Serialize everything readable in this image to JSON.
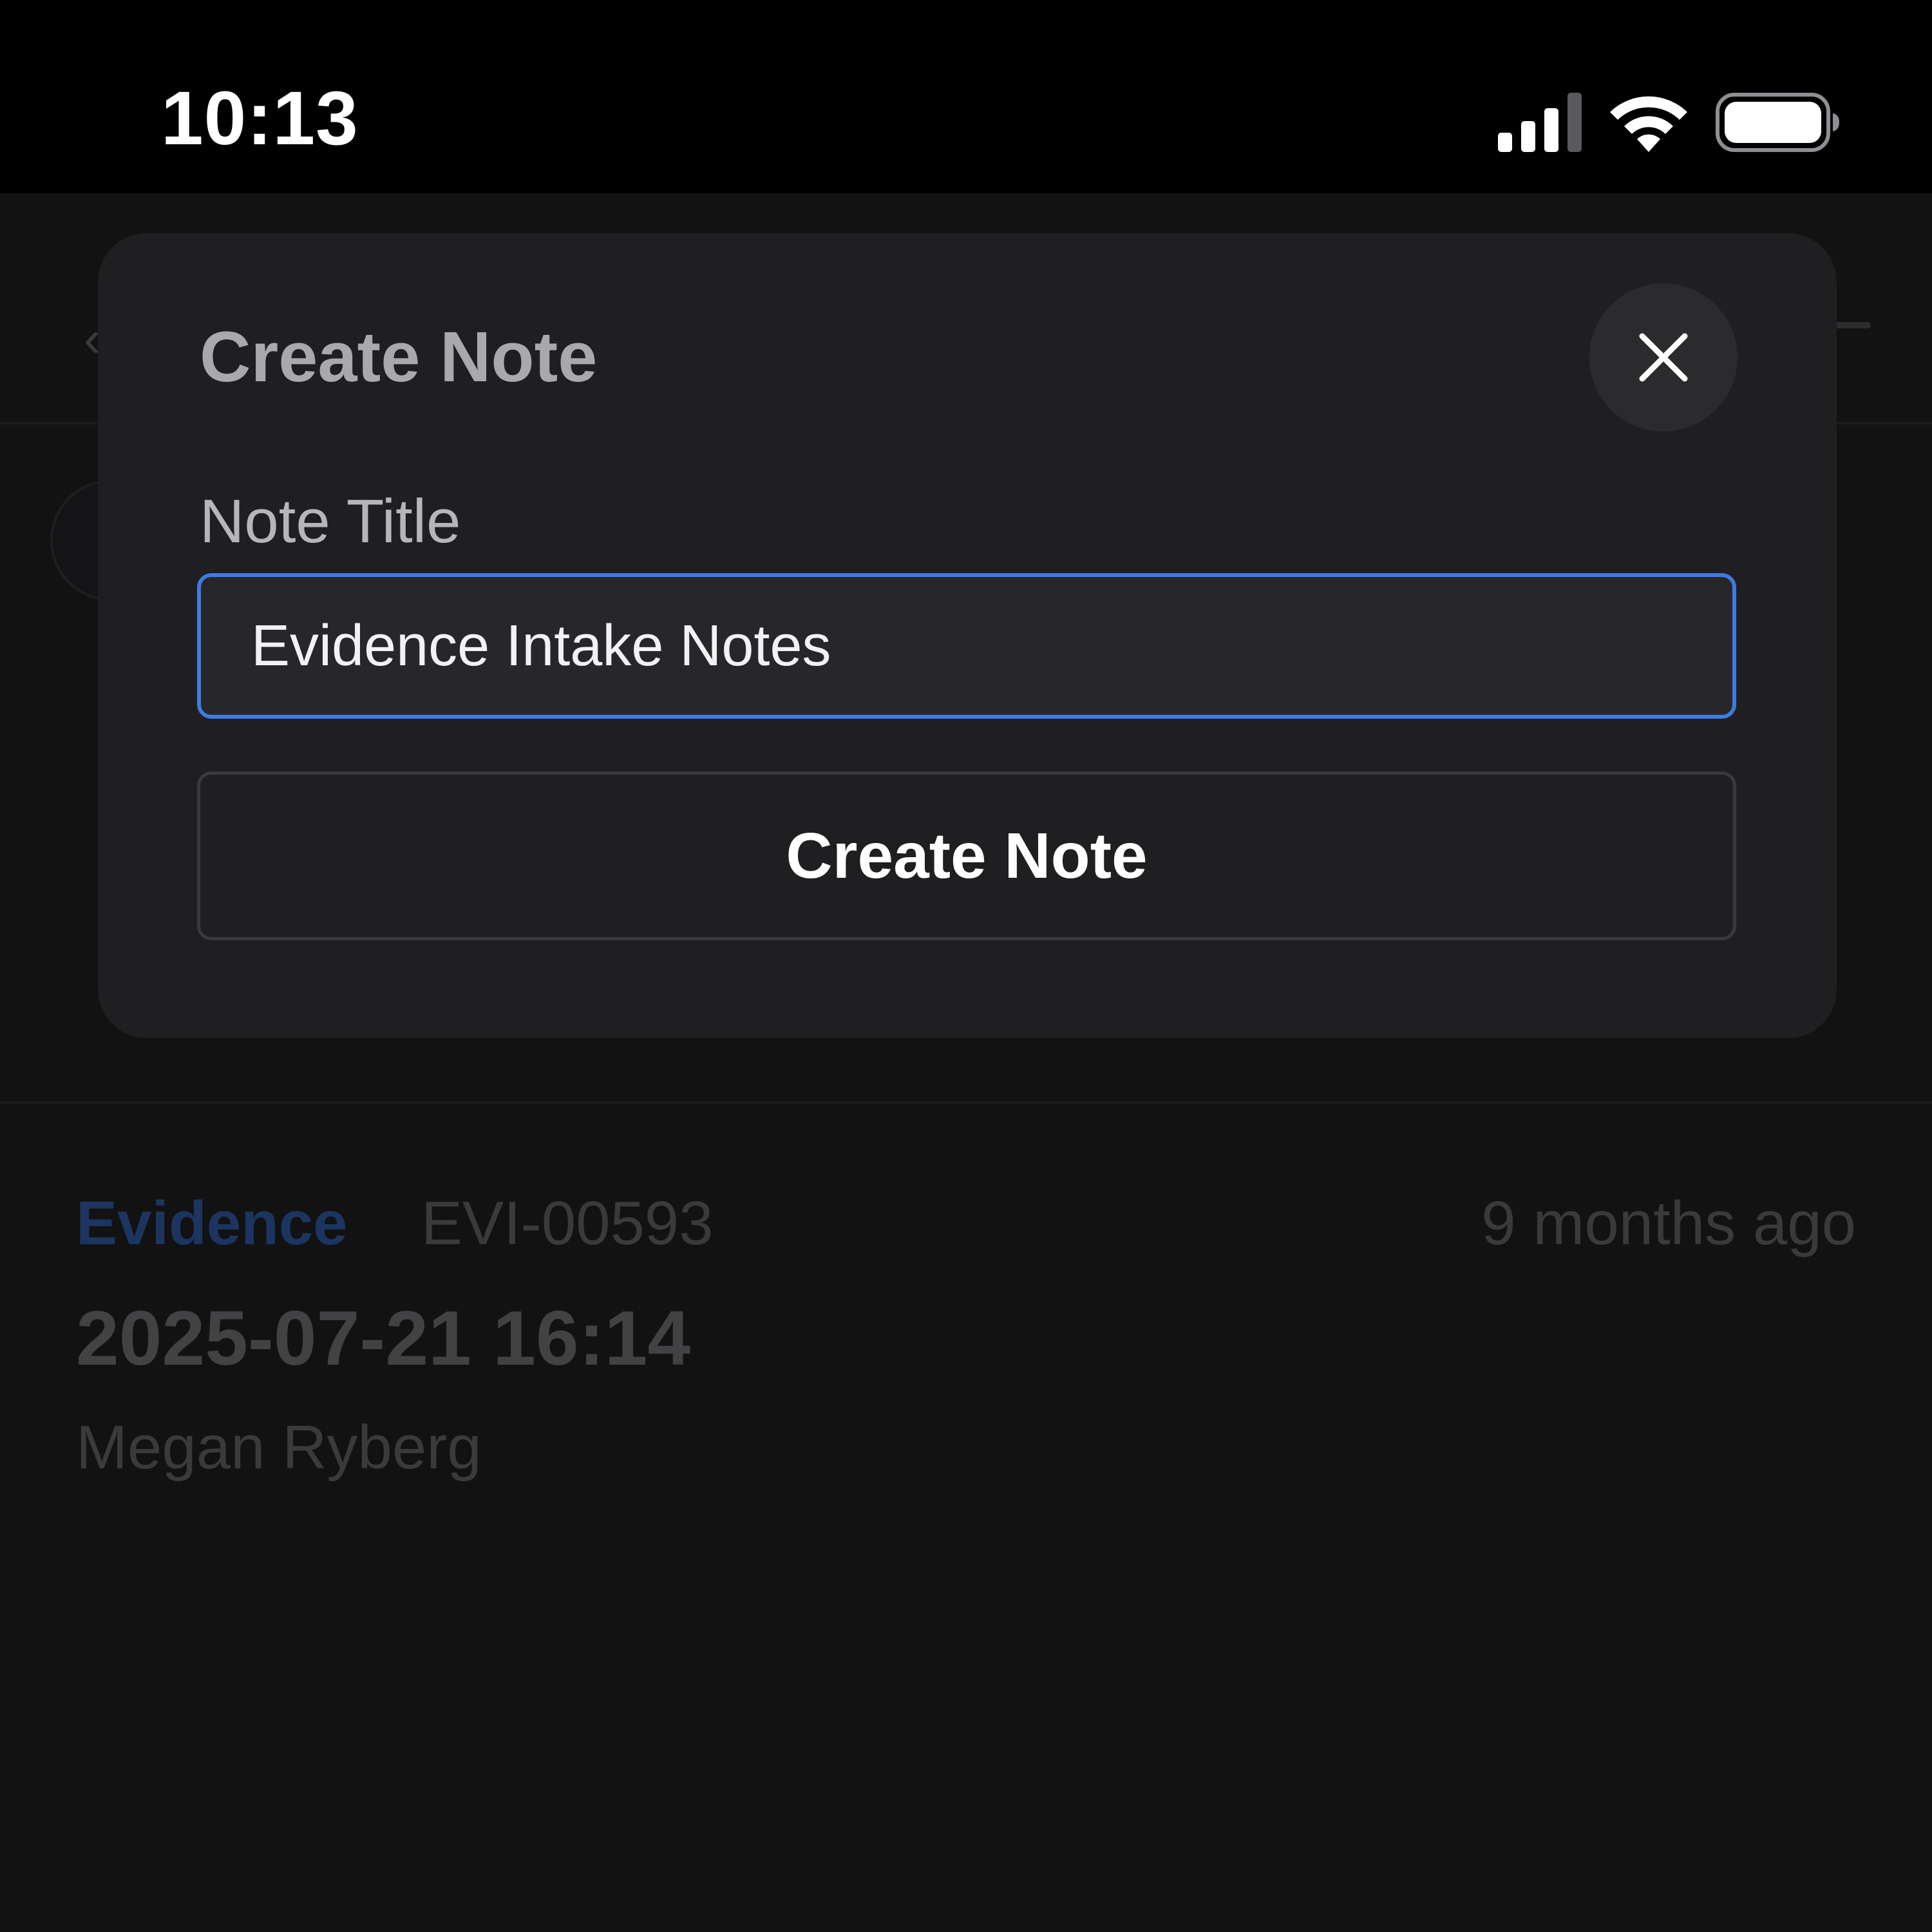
{
  "status_bar": {
    "time": "10:13",
    "icons": [
      "cellular-signal-icon",
      "wifi-icon",
      "battery-icon"
    ]
  },
  "modal": {
    "title": "Create Note",
    "close_icon": "close-icon",
    "field_label": "Note Title",
    "input_value": "Evidence Intake Notes",
    "submit_label": "Create Note"
  },
  "list": {
    "items": [
      {
        "type": "Evidence",
        "id": "EVI-00593",
        "time_ago": "9 months ago",
        "datetime": "2025-07-21 16:14",
        "author": "Megan Ryberg"
      }
    ]
  },
  "colors": {
    "accent": "#3f7be0",
    "modal_bg": "#1f1f21",
    "screen_bg": "#0b0b0c"
  }
}
